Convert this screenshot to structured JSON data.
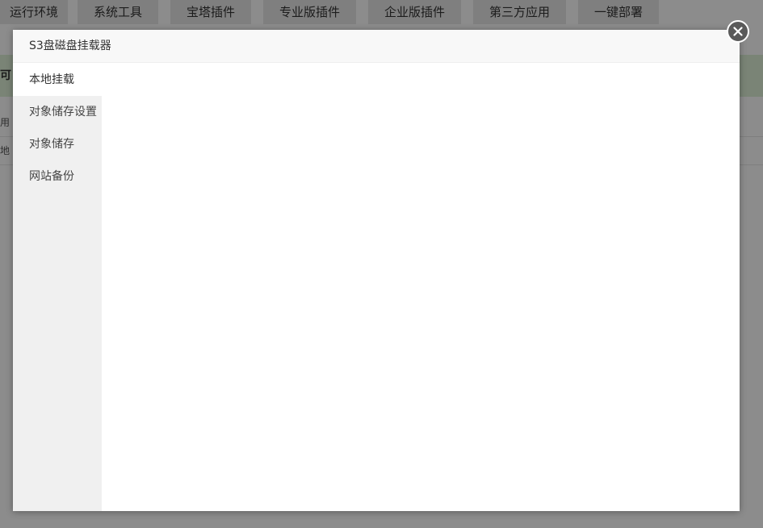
{
  "background": {
    "tabs": [
      "运行环境",
      "系统工具",
      "宝塔插件",
      "专业版插件",
      "企业版插件",
      "第三方应用",
      "一键部署"
    ],
    "band_text": "可",
    "rows": [
      "用",
      "地"
    ]
  },
  "modal": {
    "title": "S3盘磁盘挂载器",
    "sidebar": {
      "items": [
        {
          "label": "本地挂载",
          "active": true
        },
        {
          "label": "对象储存设置",
          "active": false
        },
        {
          "label": "对象储存",
          "active": false
        },
        {
          "label": "网站备份",
          "active": false
        }
      ]
    },
    "close_icon": "close-icon"
  }
}
